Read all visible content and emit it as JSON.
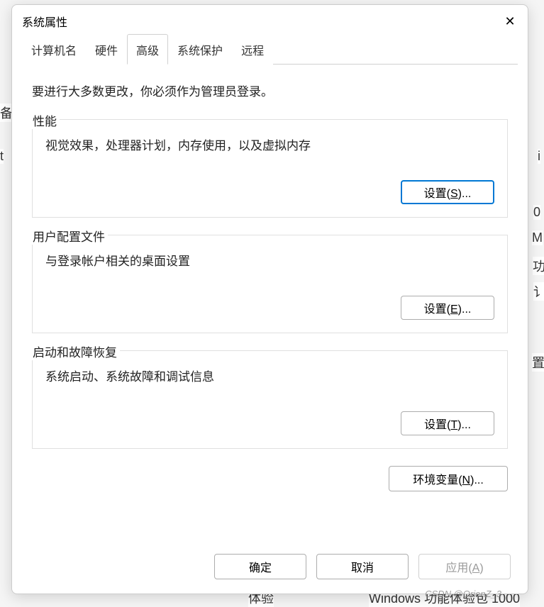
{
  "dialog": {
    "title": "系统属性"
  },
  "tabs": {
    "computer_name": "计算机名",
    "hardware": "硬件",
    "advanced": "高级",
    "system_protection": "系统保护",
    "remote": "远程"
  },
  "content": {
    "admin_note": "要进行大多数更改，你必须作为管理员登录。",
    "performance": {
      "title": "性能",
      "desc": "视觉效果，处理器计划，内存使用，以及虚拟内存",
      "button_prefix": "设置(",
      "button_key": "S",
      "button_suffix": ")..."
    },
    "user_profile": {
      "title": "用户配置文件",
      "desc": "与登录帐户相关的桌面设置",
      "button_prefix": "设置(",
      "button_key": "E",
      "button_suffix": ")..."
    },
    "startup": {
      "title": "启动和故障恢复",
      "desc": "系统启动、系统故障和调试信息",
      "button_prefix": "设置(",
      "button_key": "T",
      "button_suffix": ")..."
    },
    "env": {
      "button_prefix": "环境变量(",
      "button_key": "N",
      "button_suffix": ")..."
    }
  },
  "footer": {
    "ok": "确定",
    "cancel": "取消",
    "apply_prefix": "应用(",
    "apply_key": "A",
    "apply_suffix": ")"
  },
  "background": {
    "left1": "备",
    "left2": "t",
    "right_i": "i",
    "right_0": "0",
    "right_M": "M",
    "right_k": "功",
    "right_q1": "讠",
    "right_q2": "置",
    "bottom1": "体验",
    "bottom2": "Windows 功能体验包 1000"
  },
  "watermark": "CSDN @OrienZ_3"
}
